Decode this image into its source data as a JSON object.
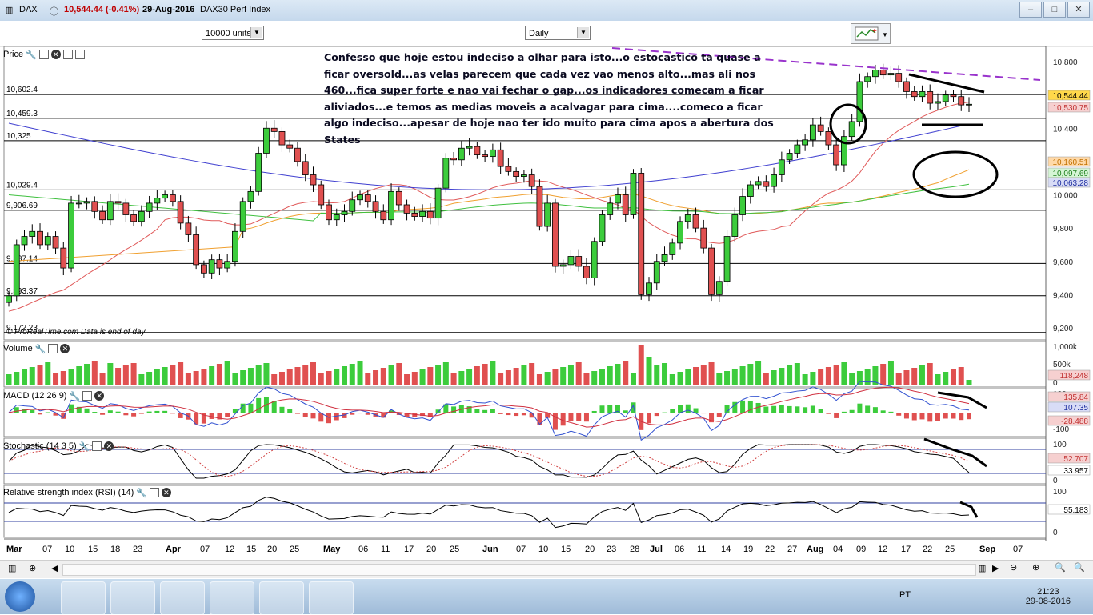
{
  "window": {
    "instrument": "DAX",
    "price_summary": "10,544.44 (-0.41%)",
    "date": "29-Aug-2016",
    "index_name": "DAX30 Perf Index"
  },
  "toolbar": {
    "units": "10000 units",
    "period": "Daily"
  },
  "panels": {
    "price": {
      "label": "Price",
      "watermark": "© ProRealTime.com  Data is end of day"
    },
    "volume": {
      "label": "Volume"
    },
    "macd": {
      "label": "MACD (12 26 9)"
    },
    "stochastic": {
      "label": "Stochastic (14 3 5)"
    },
    "rsi": {
      "label": "Relative strength index (RSI) (14)"
    }
  },
  "annotation_text": "Confesso que hoje estou indeciso a olhar para isto...o estocastico ta quase a ficar oversold...as velas parecem que cada vez vao menos alto...mas ali nos 460...fica super forte e nao vai fechar o gap...os indicadores comecam a ficar aliviados...e temos as medias moveis a acalvagar para cima....comeco a ficar algo indeciso...apesar de hoje nao ter ido muito para cima apos a abertura dos States",
  "horizontal_levels": [
    {
      "label": "10,602.4",
      "value": 10602.4
    },
    {
      "label": "10,459.3",
      "value": 10459.3
    },
    {
      "label": "10,325",
      "value": 10325
    },
    {
      "label": "10,029.4",
      "value": 10029.4
    },
    {
      "label": "9,906.69",
      "value": 9906.69
    },
    {
      "label": "9,587.14",
      "value": 9587.14
    },
    {
      "label": "9,393.37",
      "value": 9393.37
    },
    {
      "label": "9,172.23",
      "value": 9172.23
    }
  ],
  "price_axis_ticks": [
    "10,800",
    "10,600",
    "10,400",
    "10,200",
    "10,000",
    "9,800",
    "9,600",
    "9,400",
    "9,200"
  ],
  "price_axis_tick_values": [
    10800,
    10600,
    10400,
    10200,
    10000,
    9800,
    9600,
    9400,
    9200
  ],
  "price_right_boxes": [
    {
      "text": "10,544.44",
      "bg": "#ffd84a",
      "value": 10544.44
    },
    {
      "text": "10,530.75",
      "bg": "#f6d0d0",
      "value": 10530.75
    },
    {
      "text": "10,160.51",
      "bg": "#ffd9a8",
      "value": 10160.51
    },
    {
      "text": "10,097.69",
      "bg": "#d5f5d5",
      "value": 10097.69
    },
    {
      "text": "10,063.28",
      "bg": "#d8dcf6",
      "value": 10063.28
    }
  ],
  "volume_axis": {
    "ticks": [
      "1,000k",
      "500k",
      "0"
    ],
    "current": "118,248"
  },
  "macd_axis": {
    "ticks": [
      "100",
      "-100"
    ],
    "boxes": [
      "135.84",
      "107.35",
      "-28.488"
    ]
  },
  "stoch_axis": {
    "ticks": [
      "100",
      "0"
    ],
    "boxes": [
      "52.707",
      "33.957"
    ]
  },
  "rsi_axis": {
    "ticks": [
      "100",
      "0"
    ],
    "boxes": [
      "55.183"
    ]
  },
  "x_axis_labels": [
    "Mar",
    "07",
    "10",
    "15",
    "18",
    "23",
    "Apr",
    "07",
    "12",
    "15",
    "20",
    "25",
    "May",
    "06",
    "11",
    "17",
    "20",
    "25",
    "Jun",
    "07",
    "10",
    "15",
    "20",
    "23",
    "28",
    "Jul",
    "06",
    "11",
    "14",
    "19",
    "22",
    "27",
    "Aug",
    "04",
    "09",
    "12",
    "17",
    "22",
    "25",
    "Sep",
    "07"
  ],
  "taskbar": {
    "language": "PT",
    "time": "21:23",
    "date": "29-08-2016"
  },
  "colors": {
    "up": "#3ccc3c",
    "down": "#e05050",
    "ma_red": "#e05a5a",
    "ma_blue": "#4040d0",
    "ma_green": "#40c040",
    "ma_orange": "#f0a030",
    "trend_purple": "#9933cc"
  },
  "chart_data": [
    {
      "type": "candlestick",
      "title": "DAX30 Perf Index",
      "period": "Daily",
      "x_range": [
        "2016-03-01",
        "2016-08-29"
      ],
      "ylim": [
        9100,
        10900
      ],
      "closes": [
        9393,
        9700,
        9750,
        9780,
        9700,
        9750,
        9680,
        9560,
        9950,
        9950,
        9960,
        9900,
        9850,
        9960,
        9950,
        9880,
        9840,
        9900,
        9950,
        9980,
        10000,
        9960,
        9830,
        9760,
        9580,
        9530,
        9610,
        9560,
        9600,
        9780,
        9960,
        10020,
        10250,
        10400,
        10380,
        10300,
        10280,
        10200,
        10120,
        10060,
        9940,
        9850,
        9880,
        9900,
        9970,
        10000,
        9960,
        9900,
        9850,
        10020,
        9940,
        9890,
        9870,
        9900,
        9860,
        10040,
        10220,
        10210,
        10280,
        10290,
        10240,
        10230,
        10270,
        10170,
        10140,
        10110,
        10120,
        10050,
        9810,
        9950,
        9570,
        9580,
        9630,
        9570,
        9500,
        9720,
        9880,
        9950,
        10000,
        9880,
        10130,
        9400,
        9470,
        9600,
        9640,
        9710,
        9840,
        9880,
        9800,
        9680,
        9400,
        9480,
        9750,
        9880,
        9990,
        10060,
        10080,
        10050,
        10120,
        10210,
        10250,
        10300,
        10330,
        10420,
        10380,
        10300,
        10180,
        10350,
        10440,
        10680,
        10710,
        10750,
        10720,
        10730,
        10680,
        10620,
        10590,
        10620,
        10550,
        10560,
        10600,
        10590,
        10540,
        10544
      ],
      "moving_averages": [
        {
          "color": "red",
          "last": 10530.75
        },
        {
          "color": "orange",
          "last": 10160.51
        },
        {
          "color": "green",
          "last": 10097.69
        },
        {
          "color": "blue",
          "last": 10063.28
        }
      ]
    },
    {
      "type": "bar",
      "title": "Volume",
      "current": 118248,
      "ylim": [
        0,
        1000000
      ]
    },
    {
      "type": "line",
      "title": "MACD (12 26 9)",
      "values": {
        "macd": 135.84,
        "signal": 107.35,
        "histogram": -28.488
      }
    },
    {
      "type": "line",
      "title": "Stochastic (14 3 5)",
      "values": {
        "k": 52.707,
        "d": 33.957
      },
      "ylim": [
        0,
        100
      ]
    },
    {
      "type": "line",
      "title": "Relative strength index (RSI) (14)",
      "values": {
        "rsi": 55.183
      },
      "ylim": [
        0,
        100
      ]
    }
  ]
}
